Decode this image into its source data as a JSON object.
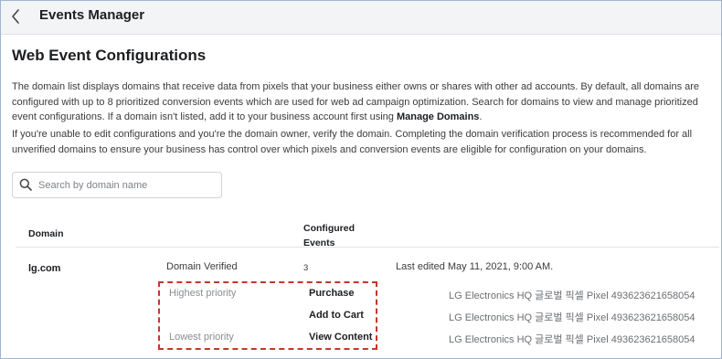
{
  "header": {
    "back_icon": "chevron-left-icon",
    "title": "Events Manager"
  },
  "page": {
    "title": "Web Event Configurations",
    "desc1_text": "The domain list displays domains that receive data from pixels that your business either owns or shares with other ad accounts. By default, all domains are configured with up to 8 prioritized conversion events which are used for web ad campaign optimization. Search for domains to view and manage prioritized event configurations. If a domain isn't listed, add it to your business account first using ",
    "desc1_link": "Manage Domains",
    "desc1_end": ".",
    "desc2": "If you're unable to edit configurations and you're the domain owner, verify the domain. Completing the domain verification process is recommended for all unverified domains to ensure your business has control over which pixels and conversion events are eligible for configuration on your domains."
  },
  "search": {
    "placeholder": "Search by domain name",
    "value": "",
    "icon": "search-icon"
  },
  "table": {
    "headers": {
      "domain": "Domain",
      "configured_events": "Configured Events"
    },
    "row": {
      "domain": "lg.com",
      "status": "Domain Verified",
      "configured_count": "3",
      "last_edited": "Last edited May 11, 2021, 9:00 AM."
    },
    "events": [
      {
        "priority": "Highest priority",
        "event": "Purchase",
        "pixel": "LG Electronics HQ 글로벌 픽셀   Pixel 493623621658054"
      },
      {
        "priority": "",
        "event": "Add to Cart",
        "pixel": "LG Electronics HQ 글로벌 픽셀   Pixel 493623621658054"
      },
      {
        "priority": "Lowest priority",
        "event": "View Content",
        "pixel": "LG Electronics HQ 글로벌 픽셀   Pixel 493623621658054"
      }
    ]
  },
  "colors": {
    "highlight_border": "#c0392b",
    "topbar_bg": "#f3f4f6"
  }
}
